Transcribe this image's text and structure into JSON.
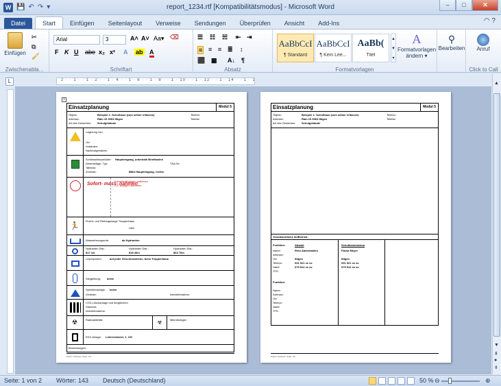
{
  "window": {
    "title": "report_1234.rtf [Kompatibilitätsmodus] - Microsoft Word",
    "app_letter": "W"
  },
  "qat": {
    "save": "💾",
    "undo": "↶",
    "redo": "↷",
    "more": "▾"
  },
  "tabs": [
    "Datei",
    "Start",
    "Einfügen",
    "Seitenlayout",
    "Verweise",
    "Sendungen",
    "Überprüfen",
    "Ansicht",
    "Add-Ins"
  ],
  "ribbon": {
    "clipboard": {
      "paste_label": "Einfügen",
      "group_label": "Zwischenabla..."
    },
    "font": {
      "font_name": "Arial",
      "font_size": "3",
      "bold": "F",
      "italic": "K",
      "underline": "U",
      "strike": "abe",
      "sub": "x₂",
      "sup": "x²",
      "grow": "A˄",
      "shrink": "A˅",
      "case": "Aa▾",
      "color": "A",
      "group_label": "Schriftart"
    },
    "paragraph": {
      "sort": "A↓",
      "pilcrow": "¶",
      "group_label": "Absatz"
    },
    "styles": {
      "items": [
        {
          "sample": "AaBbCcI",
          "name": "¶ Standard"
        },
        {
          "sample": "AaBbCcI",
          "name": "¶ Kein Lee..."
        },
        {
          "sample": "AaBb(",
          "name": "Titel"
        }
      ],
      "group_label": "Formatvorlagen",
      "change_label": "Formatvorlagen ändern ▾"
    },
    "editing": {
      "label": "Bearbeiten"
    },
    "call": {
      "label": "Anruf",
      "group_label": "Click to Call"
    }
  },
  "ruler": {
    "corner": "L",
    "marks": "2 · · 1 · · 1 · 2 · · 1 · 4 · · 1 · 6 · · 1 · 8 · · 1 · 10 · · 1 · 12 · · 1 · 14 · · 1 · 16 · · 1 · 18"
  },
  "page1": {
    "title": "Einsatzplanung",
    "modul": "Modul 5",
    "objekt_label": "Objekt:",
    "objekt_value": "Beispiel 1: Schulhaus  (zum selber erfassen)",
    "adresse_label": "Adresse:",
    "adresse_value": "Rain 15 3063 Ittigen",
    "art_label": "Art des Gewerbes:",
    "art_value": "Schulgebäude",
    "telefon_label": "Telefon:",
    "telefax_label": "Telefax:",
    "lage_label": "Lagerung von:",
    "ort_label": "Ort:",
    "anbauten_label": "Anbauten:",
    "nachbar_label": "Nachbargebäude:",
    "schluessel_label": "Schlüsseldepot/Ader:",
    "schluessel_value": "Haupteingang, unterhalb Briefkasten",
    "alarm_label": "Alarmanlage, Typ:",
    "tna_label": "TNA Nr.:",
    "tableau_label": "Tableau:",
    "zentrale_label": "Zentrale:",
    "zentrale_value": "BMA Haupteingang, rechts",
    "sofort_label": "Sofort- mass- nahmen",
    "sofort_1": "- Hubretter Bolligen aufbieten",
    "sofort_2": "- TLF Bolligen aufbieten",
    "flucht_label": "Flucht- und Rettungswege Treppenhaus",
    "lifte_label": "Lifte:",
    "wasser_label": "Wasserbezugsorte:",
    "wasser_value": "ab Hydranten",
    "hydrant_label": "Hydranten  Dist.:",
    "hydrant_1": "817     1m",
    "hydrant_2": "818     40m",
    "hydrant_3": "863     70m",
    "loesch_label": "Löschposten:",
    "loesch_value": "auf jeder Geschossebene, beim Treppenhaus",
    "steig_label": "Steigleitung:",
    "steig_value": "keine",
    "sprinkler_label": "Sprinkleranlage:",
    "sprinkler_value": "keine",
    "zentrale2_label": "Zentrale:",
    "inbetrieb_label": "Inbetriebnahme:",
    "co2_label": "CO2-Löschanlage und dergleichen",
    "standort_label": "Standort:",
    "inbetrieb2_label": "Inbetriebnahme:",
    "radio_label": "Radioaktivität:",
    "mikro_label": "Mikrobiologie:",
    "edv_label": "EDV-Anlage:",
    "edv_value": "Lehrerzimmer, 1. OG",
    "bemerk_label": "Bemerkungen:",
    "footer": "Datum:                     Erfasser:                                 Seite:  1/2"
  },
  "page2": {
    "title": "Einsatzplanung",
    "modul": "Modul 5",
    "verantwortlich": "Verantwortliche Im/Betrieb:",
    "funktion_label": "Funktion:",
    "funktion_1": "Abwart",
    "funktion_2": "Schulkommission",
    "name_label": "Name:",
    "name_1": "Reto Abdentaiden",
    "name_2": "Flavia Meyer",
    "adresse_label": "Adresse:",
    "ort_label": "Ort:",
    "ort_1": "Ittigen",
    "ort_2": "Ittigen",
    "telefon_label": "Telefon:",
    "telefon_1": "031 921 xx xx",
    "telefon_2": "031 921 xx xx",
    "natel_label": "Natel:",
    "natel_1": "079 512 xx xx",
    "natel_2": "079 512 xx xx",
    "tfs_label": "TFS:",
    "funktion2_label": "Funktion:",
    "name2_label": "Name:",
    "adresse2_label": "Adresse:",
    "ort2_label": "Ort:",
    "telefon2_label": "Telefon:",
    "natel2_label": "Natel:",
    "tfs2_label": "TFS:",
    "footer": "Datum:                     Erfasser:                                 Seite:  2/2"
  },
  "status": {
    "page": "Seite: 1 von 2",
    "words": "Wörter: 143",
    "language": "Deutsch (Deutschland)",
    "zoom": "50 %",
    "zoom_level_percent": 50
  },
  "colors": {
    "accent": "#2b579a",
    "warn": "#f0c020",
    "danger": "#d02020",
    "green": "#2e8b3c"
  }
}
